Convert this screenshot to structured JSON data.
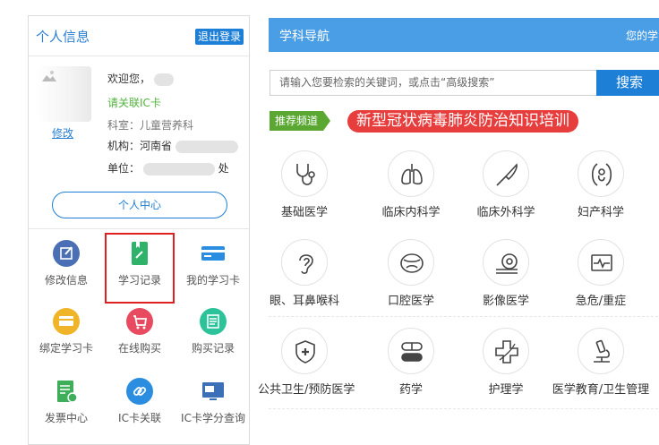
{
  "profile": {
    "title": "个人信息",
    "logout": "退出登录",
    "edit": "修改",
    "welcome": "欢迎您，",
    "link_card": "请关联IC卡",
    "dept": "科室：儿童营养科",
    "org": "机构：河南省",
    "unit_prefix": "单位：",
    "unit_suffix": "处",
    "center_button": "个人中心"
  },
  "tools": [
    {
      "label": "修改信息",
      "color": "#4a6fb5"
    },
    {
      "label": "学习记录",
      "color": "#2fb36b"
    },
    {
      "label": "我的学习卡",
      "color": "#2a8de0"
    },
    {
      "label": "绑定学习卡",
      "color": "#f0b428"
    },
    {
      "label": "在线购买",
      "color": "#e84a5f"
    },
    {
      "label": "购买记录",
      "color": "#2cc39a"
    },
    {
      "label": "发票中心",
      "color": "#3fae5a"
    },
    {
      "label": "IC卡关联",
      "color": "#2a8de0"
    },
    {
      "label": "IC卡学分查询",
      "color": "#3b6fb8"
    }
  ],
  "nav": {
    "title": "学科导航",
    "right_text": "您的学"
  },
  "search": {
    "placeholder": "请输入您要检索的关键词，或点击“高级搜索”",
    "button": "搜索"
  },
  "promo": {
    "tag": "推荐频道",
    "text": "新型冠状病毒肺炎防治知识培训"
  },
  "categories": [
    {
      "label": "基础医学",
      "icon": "stethoscope-icon"
    },
    {
      "label": "临床内科学",
      "icon": "lungs-icon"
    },
    {
      "label": "临床外科学",
      "icon": "scalpel-icon"
    },
    {
      "label": "妇产科学",
      "icon": "fetus-icon"
    },
    {
      "label": "眼、耳鼻喉科",
      "icon": "ear-icon"
    },
    {
      "label": "口腔医学",
      "icon": "mouth-icon"
    },
    {
      "label": "影像医学",
      "icon": "scanner-icon"
    },
    {
      "label": "急危/重症",
      "icon": "monitor-icon"
    },
    {
      "label": "公共卫生/预防医学",
      "icon": "shield-cross-icon"
    },
    {
      "label": "药学",
      "icon": "pill-icon"
    },
    {
      "label": "护理学",
      "icon": "nursing-icon"
    },
    {
      "label": "医学教育/卫生管理",
      "icon": "microscope-icon"
    }
  ]
}
